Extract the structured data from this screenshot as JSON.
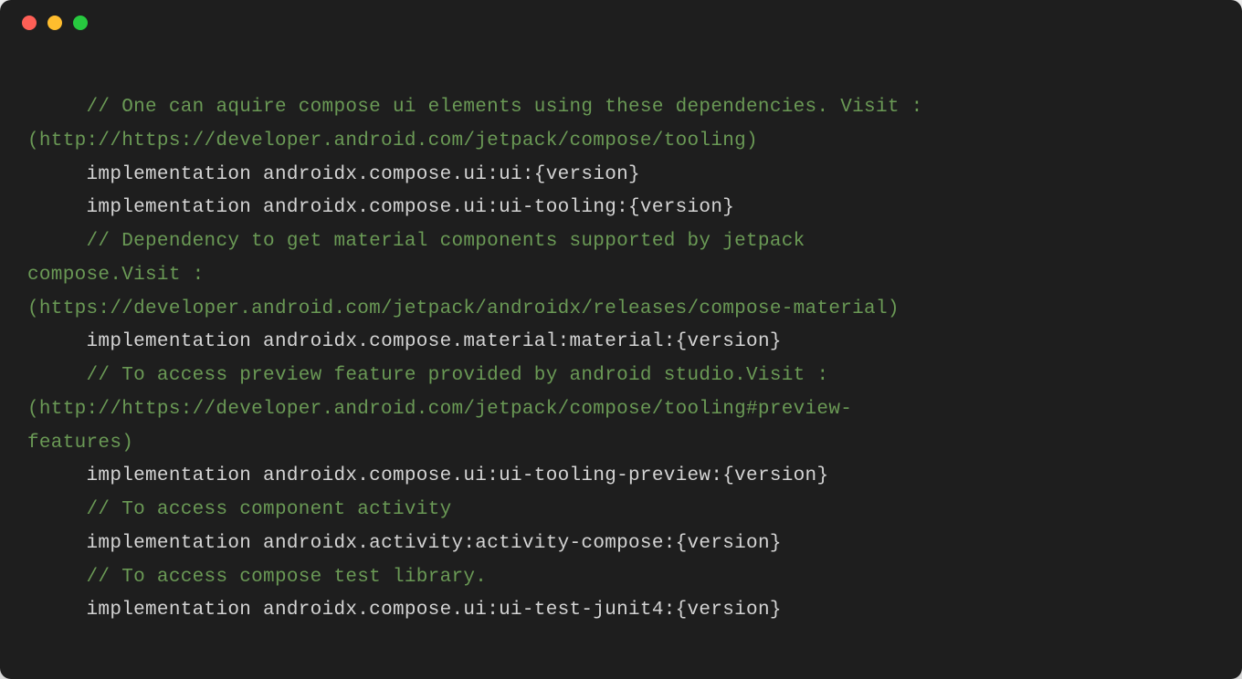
{
  "code": {
    "lines": [
      {
        "indent": 1,
        "type": "comment",
        "text": "// One can aquire compose ui elements using these dependencies. Visit : "
      },
      {
        "indent": 0,
        "type": "comment",
        "text": "(http://https://developer.android.com/jetpack/compose/tooling)"
      },
      {
        "indent": 1,
        "type": "code",
        "keyword": "implementation",
        "rest": " androidx.compose.ui:ui:{version}"
      },
      {
        "indent": 1,
        "type": "code",
        "keyword": "implementation",
        "rest": " androidx.compose.ui:ui-tooling:{version}"
      },
      {
        "indent": 1,
        "type": "comment",
        "text": "// Dependency to get material components supported by jetpack "
      },
      {
        "indent": 0,
        "type": "comment",
        "text": "compose.Visit :"
      },
      {
        "indent": 0,
        "type": "comment",
        "text": "(https://developer.android.com/jetpack/androidx/releases/compose-material)"
      },
      {
        "indent": 1,
        "type": "code",
        "keyword": "implementation",
        "rest": " androidx.compose.material:material:{version}"
      },
      {
        "indent": 1,
        "type": "comment",
        "text": "// To access preview feature provided by android studio.Visit :"
      },
      {
        "indent": 0,
        "type": "comment",
        "text": "(http://https://developer.android.com/jetpack/compose/tooling#preview-"
      },
      {
        "indent": 0,
        "type": "comment",
        "text": "features)"
      },
      {
        "indent": 1,
        "type": "code",
        "keyword": "implementation",
        "rest": " androidx.compose.ui:ui-tooling-preview:{version}"
      },
      {
        "indent": 1,
        "type": "comment",
        "text": "// To access component activity"
      },
      {
        "indent": 1,
        "type": "code",
        "keyword": "implementation",
        "rest": " androidx.activity:activity-compose:{version}"
      },
      {
        "indent": 1,
        "type": "comment",
        "text": "// To access compose test library."
      },
      {
        "indent": 1,
        "type": "code",
        "keyword": "implementation",
        "rest": " androidx.compose.ui:ui-test-junit4:{version}"
      }
    ]
  }
}
